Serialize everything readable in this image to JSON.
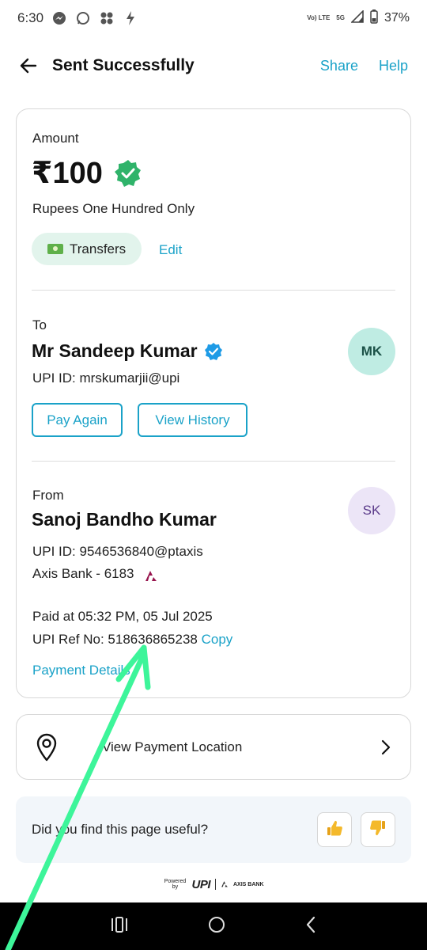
{
  "status_bar": {
    "time": "6:30",
    "network_small": "Vo) LTE",
    "network_5g": "5G",
    "battery": "37%"
  },
  "header": {
    "title": "Sent Successfully",
    "share_label": "Share",
    "help_label": "Help"
  },
  "amount_section": {
    "label": "Amount",
    "value": "₹100",
    "in_words": "Rupees One Hundred Only",
    "category_chip": "Transfers",
    "edit_label": "Edit"
  },
  "to_section": {
    "label": "To",
    "name": "Mr Sandeep Kumar",
    "upi_id": "UPI ID: mrskumarjii@upi",
    "avatar_initials": "MK",
    "pay_again_label": "Pay Again",
    "view_history_label": "View History"
  },
  "from_section": {
    "label": "From",
    "name": "Sanoj Bandho Kumar",
    "upi_id": "UPI ID: 9546536840@ptaxis",
    "bank": "Axis Bank - 6183",
    "avatar_initials": "SK",
    "paid_at": "Paid at 05:32 PM, 05 Jul 2025",
    "ref_no": "UPI Ref No: 518636865238",
    "copy_label": "Copy",
    "payment_details_label": "Payment Details"
  },
  "location_card": {
    "label": "View Payment Location"
  },
  "feedback": {
    "question": "Did you find this page useful?"
  },
  "footer": {
    "powered_by": "Powered by",
    "upi_text": "UPI",
    "bank_text": "AXIS BANK"
  },
  "colors": {
    "accent": "#1aa2c8",
    "success_green": "#2fb36a",
    "verified_blue": "#1e9be6",
    "arrow_annotation": "#3df59a"
  },
  "icons": {
    "back": "arrow-left-icon",
    "verified": "verified-badge-icon",
    "location": "map-pin-icon",
    "chevron": "chevron-right-icon",
    "thumbs_up": "thumbs-up-icon",
    "thumbs_down": "thumbs-down-icon"
  }
}
